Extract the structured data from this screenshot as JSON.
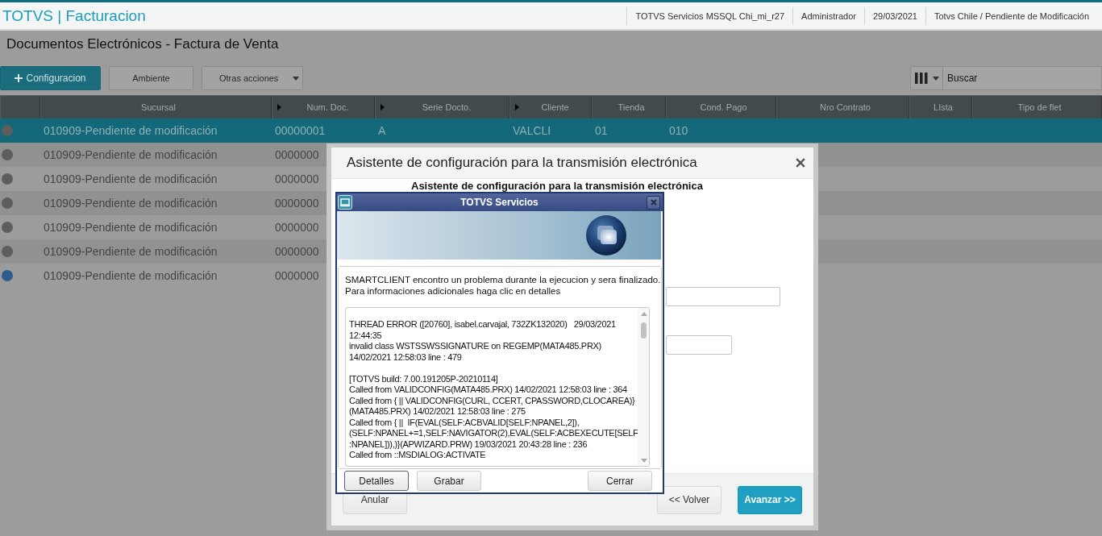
{
  "app_header": {
    "brand": "TOTVS | Facturacion",
    "info": [
      "TOTVS Servicios MSSQL Chi_mi_r27",
      "Administrador",
      "29/03/2021",
      "Totvs Chile / Pendiente de Modificación"
    ]
  },
  "page_title": "Documentos Electrónicos - Factura de Venta",
  "toolbar": {
    "buttons": [
      {
        "label": "Configuracion",
        "kind": "primary"
      },
      {
        "label": "Ambiente",
        "kind": "plain"
      },
      {
        "label": "Otras acciones",
        "kind": "menu"
      }
    ],
    "search": {
      "placeholder": "Buscar"
    }
  },
  "table": {
    "columns": [
      {
        "label": "Sucursal",
        "indicator": false
      },
      {
        "label": "Num. Doc.",
        "indicator": true
      },
      {
        "label": "Serie Docto.",
        "indicator": true
      },
      {
        "label": "Cliente",
        "indicator": true
      },
      {
        "label": "Tienda",
        "indicator": false
      },
      {
        "label": "Cond. Pago",
        "indicator": false
      },
      {
        "label": "Nro Contrato",
        "indicator": false
      },
      {
        "label": "LIsta",
        "indicator": false
      },
      {
        "label": "Tipo de flet",
        "indicator": false
      }
    ],
    "rows": [
      {
        "selected": true,
        "color": "#5e5e5e",
        "cells": [
          "010909-Pendiente de modificación",
          "00000001",
          "A",
          "VALCLI",
          "01",
          "010"
        ]
      },
      {
        "selected": false,
        "color": "#5e5e5e",
        "cells": [
          "010909-Pendiente de modificación",
          "0000000"
        ]
      },
      {
        "selected": false,
        "color": "#5e5e5e",
        "cells": [
          "010909-Pendiente de modificación",
          "0000000"
        ]
      },
      {
        "selected": false,
        "color": "#5e5e5e",
        "cells": [
          "010909-Pendiente de modificación",
          "0000000"
        ]
      },
      {
        "selected": false,
        "color": "#5e5e5e",
        "cells": [
          "010909-Pendiente de modificación",
          "0000000"
        ]
      },
      {
        "selected": false,
        "color": "#5e5e5e",
        "cells": [
          "010909-Pendiente de modificación",
          "0000000"
        ]
      },
      {
        "selected": false,
        "color": "#2f5b8e",
        "cells": [
          "010909-Pendiente de modificación",
          "0000000"
        ]
      }
    ]
  },
  "wizard_dialog": {
    "title": "Asistente de configuración para la transmisión electrónica",
    "heading": "Asistente de configuración para la transmisión electrónica",
    "fields": [
      {
        "kind": "wide"
      },
      {
        "kind": "narrow"
      }
    ],
    "left_buttons": [
      {
        "label": "Anular",
        "kind": "plain"
      }
    ],
    "right_buttons": [
      {
        "label": "<< Volver",
        "kind": "plain"
      },
      {
        "label": "Avanzar >>",
        "kind": "primary"
      }
    ]
  },
  "error_dialog": {
    "title": "TOTVS Servicios",
    "message": [
      "SMARTCLIENT encontro un problema durante la ejecucion y sera finalizado.",
      "Para informaciones adicionales haga clic en detalles"
    ],
    "log": [
      [
        "THREAD ERROR ([20760], isabel.carvajal, 732ZK132020)   29/03/2021",
        "12:44:35",
        "invalid class WSTSSWSSIGNATURE on REGEMP(MATA485.PRX)",
        "14/02/2021 12:58:03 line : 479"
      ],
      [
        "[TOTVS build: 7.00.191205P-20210114]",
        "Called from VALIDCONFIG(MATA485.PRX) 14/02/2021 12:58:03 line : 364",
        "Called from { || VALIDCONFIG(CURL, CCERT, CPASSWORD,CLOCAREA)}",
        "(MATA485.PRX) 14/02/2021 12:58:03 line : 275",
        "Called from { ||  IF(EVAL(SELF:ACBVALID[SELF:NPANEL,2]),",
        "(SELF:NPANEL+=1,SELF:NAVIGATOR(2),EVAL(SELF:ACBEXECUTE[SELF",
        ":NPANEL])),)}(APWIZARD.PRW) 19/03/2021 20:43:28 line : 236",
        "Called from ::MSDIALOG:ACTIVATE"
      ]
    ],
    "left_buttons": [
      {
        "label": "Detalles",
        "focused": true
      },
      {
        "label": "Grabar",
        "focused": false
      }
    ],
    "right_buttons": [
      {
        "label": "Cerrar",
        "focused": false
      }
    ]
  }
}
